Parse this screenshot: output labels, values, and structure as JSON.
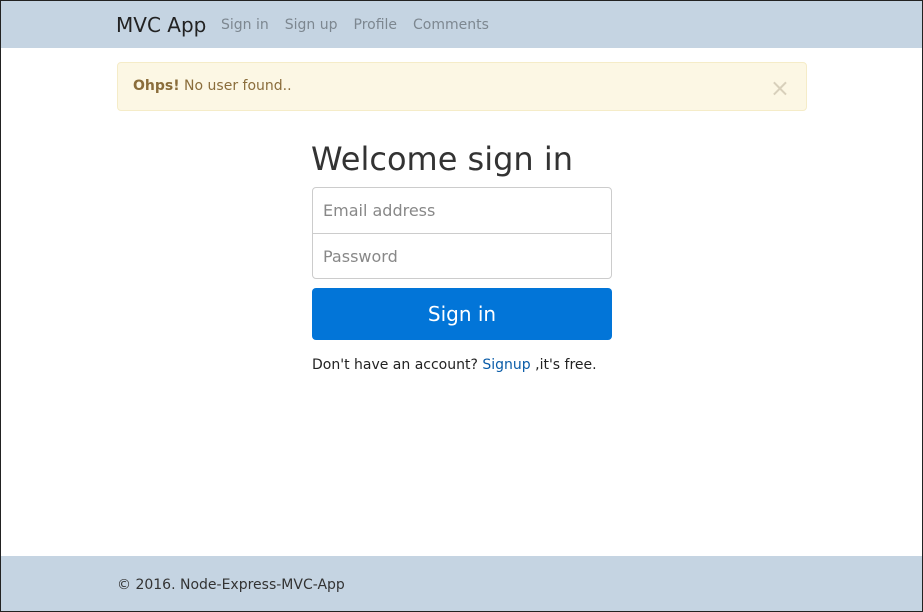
{
  "nav": {
    "brand": "MVC App",
    "links": [
      "Sign in",
      "Sign up",
      "Profile",
      "Comments"
    ]
  },
  "alert": {
    "strong": "Ohps!",
    "message": " No user found..",
    "close": "×"
  },
  "form": {
    "title": "Welcome sign in",
    "email_placeholder": "Email address",
    "password_placeholder": "Password",
    "submit": "Sign in",
    "prompt": "Don't have an account? ",
    "link": "Signup",
    "suffix": " ,it's free."
  },
  "footer": {
    "text": "© 2016. Node-Express-MVC-App"
  }
}
